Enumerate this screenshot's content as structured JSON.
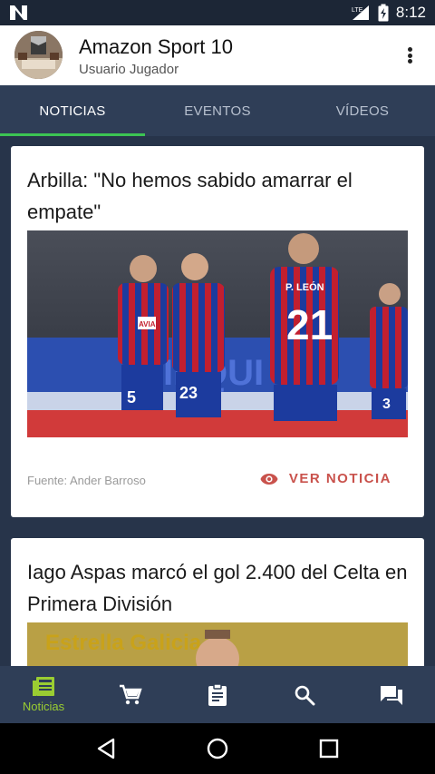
{
  "status_bar": {
    "time": "8:12",
    "network_label": "LTE",
    "icons": [
      "notification-n-icon",
      "signal-icon",
      "battery-icon"
    ]
  },
  "header": {
    "title": "Amazon Sport 10",
    "subtitle": "Usuario Jugador",
    "menu_icon": "more-vert-icon"
  },
  "tabs": [
    {
      "label": "NOTICIAS",
      "active": true
    },
    {
      "label": "EVENTOS",
      "active": false
    },
    {
      "label": "VÍDEOS",
      "active": false
    }
  ],
  "news": [
    {
      "title": "Arbilla: \"No hemos sabido amarrar el empate\"",
      "source": "Fuente: Ander Barroso",
      "action_label": "VER NOTICIA",
      "image_jersey_numbers": [
        "5",
        "23",
        "21",
        "3"
      ],
      "image_player_name": "P. LEÓN",
      "image_sponsor": "AVIA"
    },
    {
      "title": "Iago Aspas marcó el gol 2.400 del Celta en Primera División",
      "image_sponsor": "Estrella Galicia"
    }
  ],
  "bottom_nav": [
    {
      "icon": "news-icon",
      "label": "Noticias",
      "active": true
    },
    {
      "icon": "cart-icon",
      "label": "",
      "active": false
    },
    {
      "icon": "clipboard-icon",
      "label": "",
      "active": false
    },
    {
      "icon": "search-icon",
      "label": "",
      "active": false
    },
    {
      "icon": "chat-icon",
      "label": "",
      "active": false
    }
  ],
  "colors": {
    "accent_green": "#3cc453",
    "nav_active": "#9acd32",
    "link_red": "#c9524c",
    "bar_blue": "#2f3e57"
  }
}
